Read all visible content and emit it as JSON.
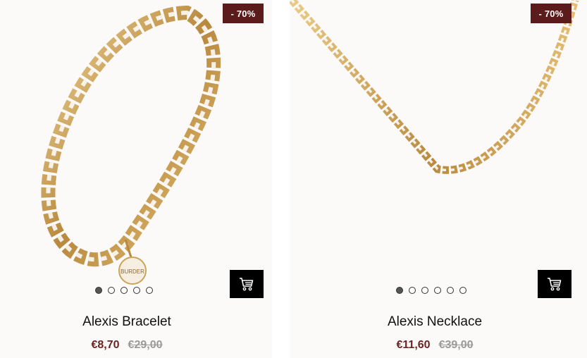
{
  "products": [
    {
      "name": "Alexis Bracelet",
      "discount_badge": "- 70%",
      "sale_price": "€8,70",
      "old_price": "€29,00",
      "image_icon": "gold-bracelet-image",
      "charm_text": "BURDER",
      "carousel_total": 5,
      "carousel_active": 1,
      "cart_icon": "shopping-cart-icon"
    },
    {
      "name": "Alexis Necklace",
      "discount_badge": "- 70%",
      "sale_price": "€11,60",
      "old_price": "€39,00",
      "image_icon": "gold-necklace-image",
      "carousel_total": 6,
      "carousel_active": 1,
      "cart_icon": "shopping-cart-icon"
    }
  ],
  "colors": {
    "card_bg": "#fcfaf8",
    "badge_bg": "#5c1b1b",
    "sale_price": "#6b2323",
    "old_price": "#9a9a9a",
    "gold": "#c9a45a",
    "cart_button_bg": "#000000"
  }
}
